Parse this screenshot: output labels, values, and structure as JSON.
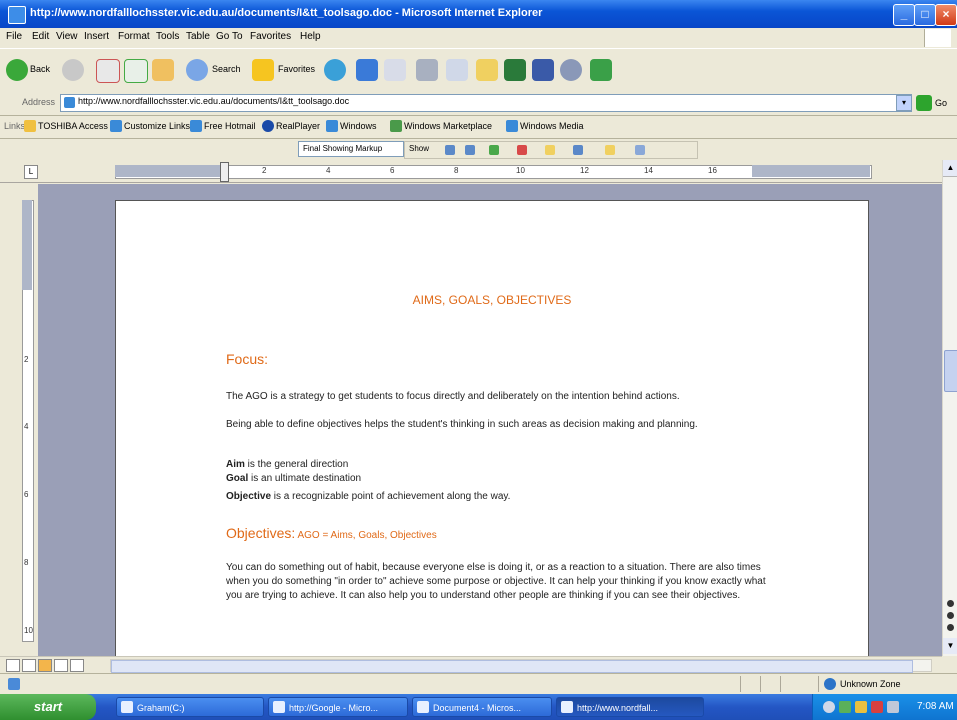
{
  "window": {
    "title": "http://www.nordfalllochsster.vic.edu.au/documents/I&tt_toolsago.doc - Microsoft Internet Explorer",
    "buttons": {
      "minimize": "_",
      "maximize": "□",
      "close": "×"
    }
  },
  "menu": [
    "File",
    "Edit",
    "View",
    "Insert",
    "Format",
    "Tools",
    "Table",
    "Go To",
    "Favorites",
    "Help"
  ],
  "toolbar": {
    "back_label": "Back",
    "search_label": "Search",
    "favorites_label": "Favorites"
  },
  "address": {
    "label": "Address",
    "url": "http://www.nordfalllochsster.vic.edu.au/documents/I&tt_toolsago.doc",
    "go_label": "Go"
  },
  "links": {
    "label": "Links",
    "items": [
      "TOSHIBA Access",
      "Customize Links",
      "Free Hotmail",
      "RealPlayer",
      "Windows",
      "Windows Marketplace",
      "Windows Media"
    ]
  },
  "reviewing": {
    "markup_select": "Final Showing Markup",
    "show_label": "Show"
  },
  "ruler": {
    "tab_button": "L",
    "numbers": [
      "2",
      "4",
      "6",
      "8",
      "10",
      "12",
      "14",
      "16"
    ]
  },
  "vruler": {
    "numbers": [
      "2",
      "4",
      "6",
      "8",
      "10"
    ]
  },
  "document": {
    "title": "AIMS, GOALS, OBJECTIVES",
    "focus_heading": "Focus:",
    "focus_p1": "The AGO is a strategy to get students to focus directly and deliberately on the intention behind actions.",
    "focus_p2": "Being able to define objectives helps the student's thinking in such areas as decision making and planning.",
    "aim_term": "Aim",
    "aim_def": " is the general direction",
    "goal_term": "Goal",
    "goal_def": " is an ultimate destination",
    "objective_term": "Objective",
    "objective_def": " is a recognizable point of achievement along the way.",
    "objectives_heading": "Objectives:",
    "objectives_sub": " AGO = Aims, Goals, Objectives",
    "objectives_p1": "You can do something out of habit, because everyone else is doing it, or as a reaction to a situation. There are also times when you do something \"in order to\" achieve some purpose or objective. It can help your thinking if you know exactly what you are trying to achieve. It can also help you to understand other people are thinking if you can see their objectives."
  },
  "status": {
    "zone": "Unknown Zone"
  },
  "taskbar": {
    "start_label": "start",
    "tasks": [
      "Graham(C:)",
      "http://Google - Micro...",
      "Document4 - Micros...",
      "http://www.nordfall..."
    ],
    "clock": "7:08 AM"
  },
  "colors": {
    "heading": "#e06a18",
    "taskbar": "#2456c4",
    "doc_background": "#9a9fb7"
  }
}
